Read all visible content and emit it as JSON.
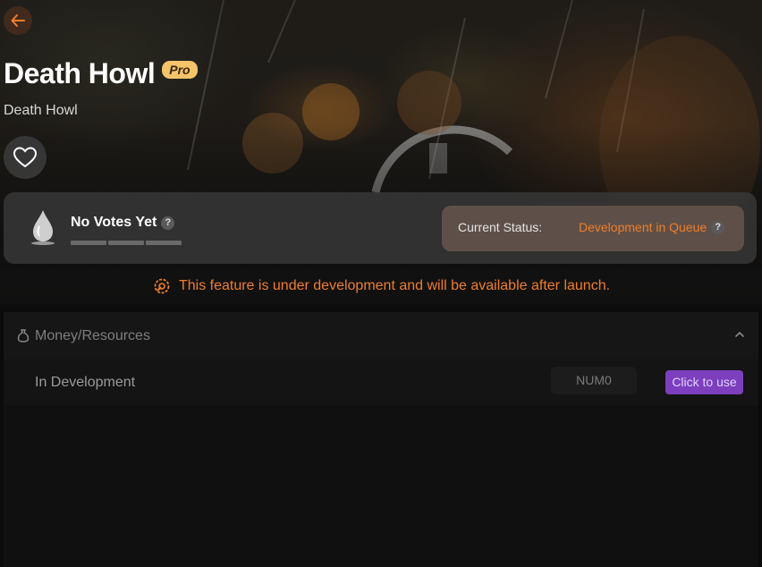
{
  "header": {
    "back_icon": "arrow-left-icon",
    "title": "Death Howl",
    "badge": "Pro",
    "subtitle": "Death Howl",
    "favorite_icon": "heart-icon"
  },
  "votes": {
    "icon": "droplet-icon",
    "title": "No Votes Yet",
    "help": "?",
    "status_label": "Current Status:",
    "status_value": "Development in Queue",
    "status_help": "?"
  },
  "notice": {
    "icon": "gear-wrench-icon",
    "text": "This feature is under development and will be available after launch."
  },
  "section": {
    "icon": "money-bag-icon",
    "title": "Money/Resources",
    "chevron_icon": "chevron-up-icon",
    "rows": [
      {
        "label": "In Development",
        "input_value": "NUM0",
        "button": "Click to use"
      }
    ]
  },
  "colors": {
    "accent_orange": "#f07d2a",
    "pro_badge": "#f5c36a",
    "use_button": "#7d3fbe"
  }
}
